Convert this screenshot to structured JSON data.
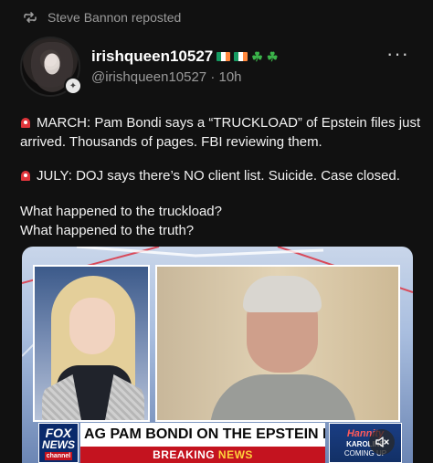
{
  "repost": {
    "icon": "repost-icon",
    "text": "Steve Bannon reposted"
  },
  "author": {
    "display_name": "irishqueen10527",
    "name_emojis": [
      "irish-flag",
      "irish-flag",
      "shamrock",
      "shamrock"
    ],
    "handle": "@irishqueen10527",
    "separator": "·",
    "time": "10h",
    "avatar": "avatar",
    "badge_icon": "verified-badge-icon"
  },
  "more_label": "···",
  "post": {
    "para1": "MARCH: Pam Bondi says a “TRUCKLOAD” of Epstein files just arrived. Thousands of pages. FBI reviewing them.",
    "para2": "JULY: DOJ says there’s NO client list. Suicide. Case closed.",
    "para3_line1": "What happened to the truckload?",
    "para3_line2": "What happened to the truth?"
  },
  "media": {
    "network_logo_line1": "FOX",
    "network_logo_line2": "NEWS",
    "network_logo_line3": "channel",
    "headline": "AG PAM BONDI ON THE EPSTEIN FILES",
    "breaking_prefix": "BREAKING ",
    "breaking_suffix": "NEWS",
    "promo_line1": "Hannity",
    "promo_line2": "KAROLINE",
    "promo_line3": "COMING UP",
    "mute_icon": "speaker-muted-icon"
  },
  "colors": {
    "background": "#111111",
    "text_primary": "#f2f2f2",
    "text_secondary": "#9a9a9a",
    "siren_red": "#e0353b",
    "fox_blue": "#0a2a6b",
    "breaking_red": "#c4131f"
  }
}
